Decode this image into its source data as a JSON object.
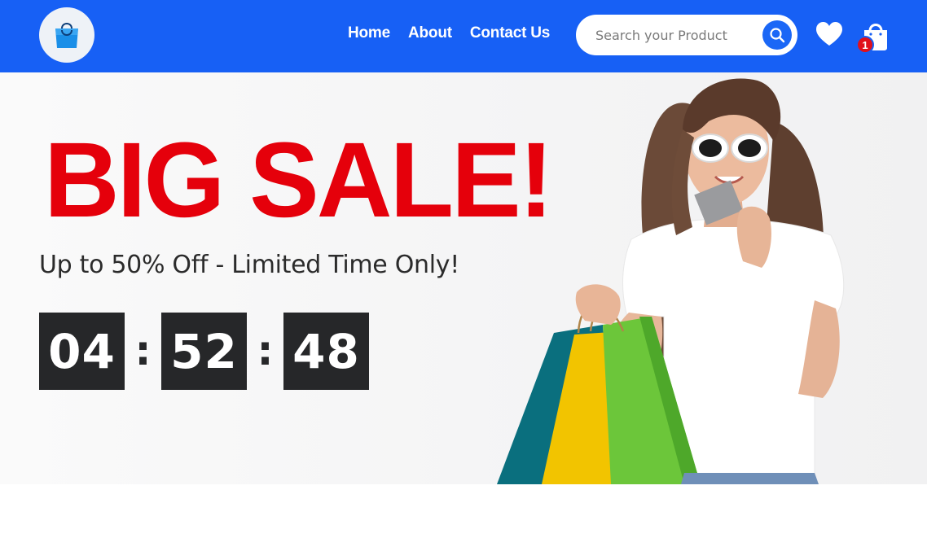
{
  "header": {
    "logo_icon": "shopping-bag-icon",
    "nav": [
      {
        "label": "Home"
      },
      {
        "label": "About"
      },
      {
        "label": "Contact Us"
      }
    ],
    "search": {
      "placeholder": "Search your Product",
      "value": "",
      "icon": "search-icon"
    },
    "wishlist_icon": "heart-icon",
    "cart": {
      "icon": "shopping-bag-icon",
      "count": "1"
    },
    "colors": {
      "bar": "#1760f5",
      "badge": "#e0101b"
    }
  },
  "hero": {
    "title": "BIG SALE!",
    "subtitle": "Up to 50% Off - Limited Time Only!",
    "countdown": {
      "hours": "04",
      "minutes": "52",
      "seconds": "48",
      "separator": ":"
    },
    "image": "woman-with-shopping-bags",
    "colors": {
      "title": "#e5000b",
      "countdown_bg": "#262729"
    }
  }
}
